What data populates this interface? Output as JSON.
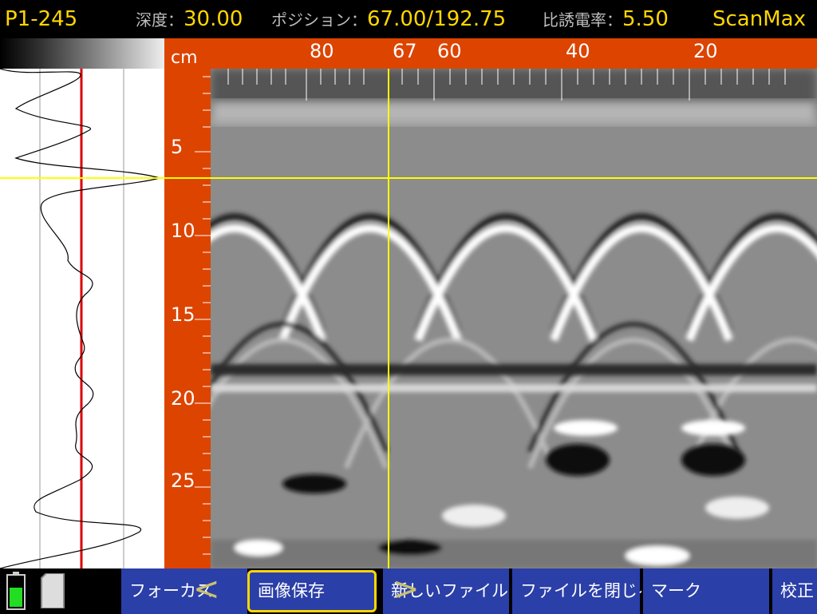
{
  "header": {
    "file_id": "P1-245",
    "depth_label": "深度：",
    "depth_value": "30.00",
    "position_label": "ポジション：",
    "position_value": "67.00/192.75",
    "permittivity_label": "比誘電率：",
    "permittivity_value": "5.50",
    "brand": "ScanMax"
  },
  "axes": {
    "unit": "cm",
    "depth_ticks": [
      "5",
      "10",
      "15",
      "20",
      "25"
    ],
    "position_ticks": [
      "80",
      "67",
      "60",
      "40",
      "20"
    ]
  },
  "cursor": {
    "position_cm": 67,
    "depth_cm": 6.5
  },
  "toolbar": {
    "focus": "フォーカス",
    "save_image": "画像保存",
    "new_file": "新しいファイル",
    "close_file": "ファイルを閉じる",
    "mark": "マーク",
    "calibrate": "校正",
    "prev_icon": "chevron-left-icon",
    "next_icon": "chevron-right-icon"
  },
  "status": {
    "battery_level": 0.6,
    "battery_icon": "battery-icon",
    "sd_icon": "sd-card-icon"
  },
  "colors": {
    "accent": "#dd4400",
    "highlight": "#ffd700",
    "button": "#2b3fa8",
    "cursor": "#ffff00",
    "trace_marker": "#dd0000"
  }
}
